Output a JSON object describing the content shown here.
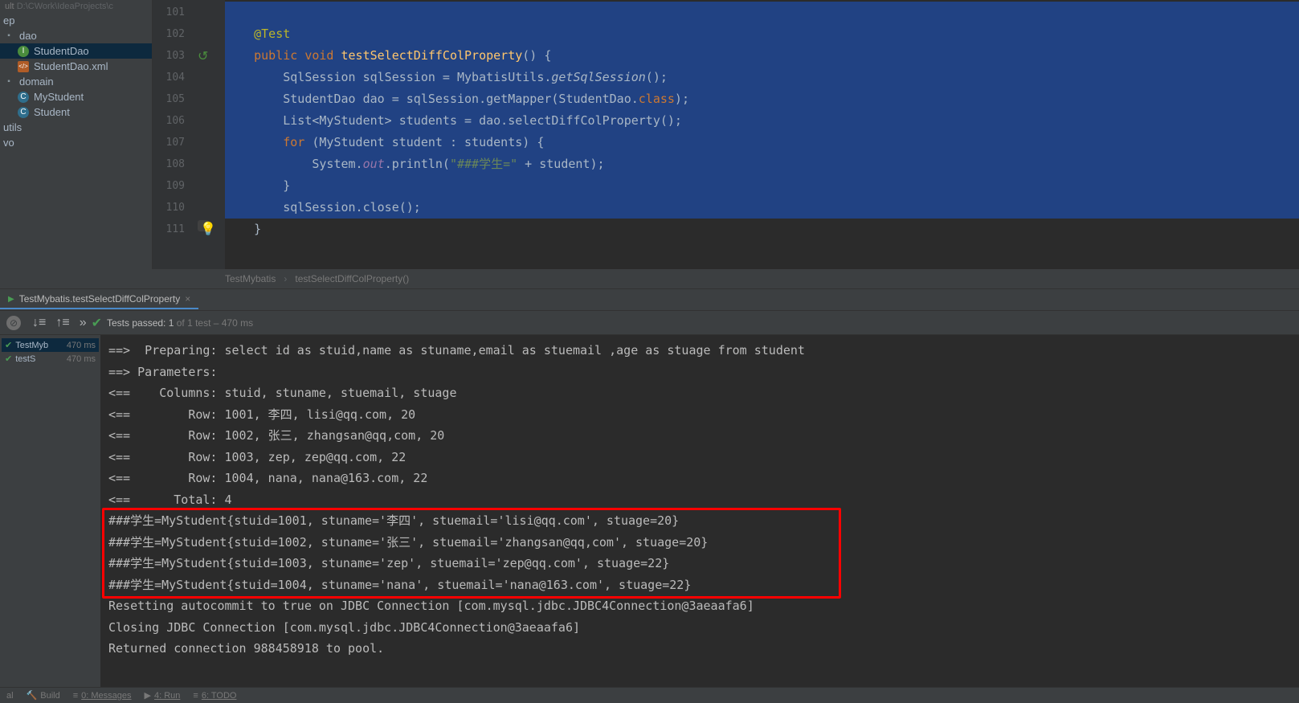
{
  "project": {
    "path": "D:\\CWork\\IdeaProjects\\c",
    "items": [
      {
        "label": "ep",
        "level": 1,
        "icon": "folder"
      },
      {
        "label": "dao",
        "level": 1,
        "icon": "folder"
      },
      {
        "label": "StudentDao",
        "level": 2,
        "icon": "interface",
        "selected": true
      },
      {
        "label": "StudentDao.xml",
        "level": 2,
        "icon": "xml"
      },
      {
        "label": "domain",
        "level": 1,
        "icon": "folder"
      },
      {
        "label": "MyStudent",
        "level": 2,
        "icon": "class"
      },
      {
        "label": "Student",
        "level": 2,
        "icon": "class"
      },
      {
        "label": "utils",
        "level": 1,
        "icon": "folder"
      },
      {
        "label": "vo",
        "level": 1,
        "icon": "folder"
      }
    ]
  },
  "editor": {
    "lines": [
      "101",
      "102",
      "103",
      "104",
      "105",
      "106",
      "107",
      "108",
      "109",
      "110",
      "111"
    ],
    "code": {
      "l101": "",
      "l102_anno": "@Test",
      "l103_kw1": "public",
      "l103_kw2": "void",
      "l103_method": "testSelectDiffColProperty",
      "l103_end": "() {",
      "l104": "        SqlSession sqlSession = MybatisUtils.",
      "l104_static": "getSqlSession",
      "l104_end": "();",
      "l105": "        StudentDao dao = sqlSession.getMapper(StudentDao.",
      "l105_kw": "class",
      "l105_end": ");",
      "l106": "        List<MyStudent> students = dao.selectDiffColProperty();",
      "l107_kw": "for",
      "l107_rest": " (MyStudent student : students) {",
      "l108_a": "            System.",
      "l108_field": "out",
      "l108_b": ".println(",
      "l108_str": "\"###学生=\"",
      "l108_c": " + student);",
      "l109": "        }",
      "l110": "        sqlSession.close();",
      "l111": "}"
    }
  },
  "breadcrumb": {
    "item1": "TestMybatis",
    "item2": "testSelectDiffColProperty()"
  },
  "run_tab": {
    "label": "TestMybatis.testSelectDiffColProperty"
  },
  "test_toolbar": {
    "status_prefix": "Tests passed: 1",
    "status_suffix": " of 1 test – 470 ms"
  },
  "test_tree": [
    {
      "label": "TestMyb",
      "time": "470 ms",
      "selected": true
    },
    {
      "label": "testS",
      "time": "470 ms",
      "selected": false
    }
  ],
  "console": [
    "==>  Preparing: select id as stuid,name as stuname,email as stuemail ,age as stuage from student",
    "==> Parameters:",
    "<==    Columns: stuid, stuname, stuemail, stuage",
    "<==        Row: 1001, 李四, lisi@qq.com, 20",
    "<==        Row: 1002, 张三, zhangsan@qq,com, 20",
    "<==        Row: 1003, zep, zep@qq.com, 22",
    "<==        Row: 1004, nana, nana@163.com, 22",
    "<==      Total: 4",
    "###学生=MyStudent{stuid=1001, stuname='李四', stuemail='lisi@qq.com', stuage=20}",
    "###学生=MyStudent{stuid=1002, stuname='张三', stuemail='zhangsan@qq,com', stuage=20}",
    "###学生=MyStudent{stuid=1003, stuname='zep', stuemail='zep@qq.com', stuage=22}",
    "###学生=MyStudent{stuid=1004, stuname='nana', stuemail='nana@163.com', stuage=22}",
    "Resetting autocommit to true on JDBC Connection [com.mysql.jdbc.JDBC4Connection@3aeaafa6]",
    "Closing JDBC Connection [com.mysql.jdbc.JDBC4Connection@3aeaafa6]",
    "Returned connection 988458918 to pool."
  ],
  "status_bar": {
    "build": "Build",
    "messages": "0: Messages",
    "run": "4: Run",
    "todo": "6: TODO"
  }
}
